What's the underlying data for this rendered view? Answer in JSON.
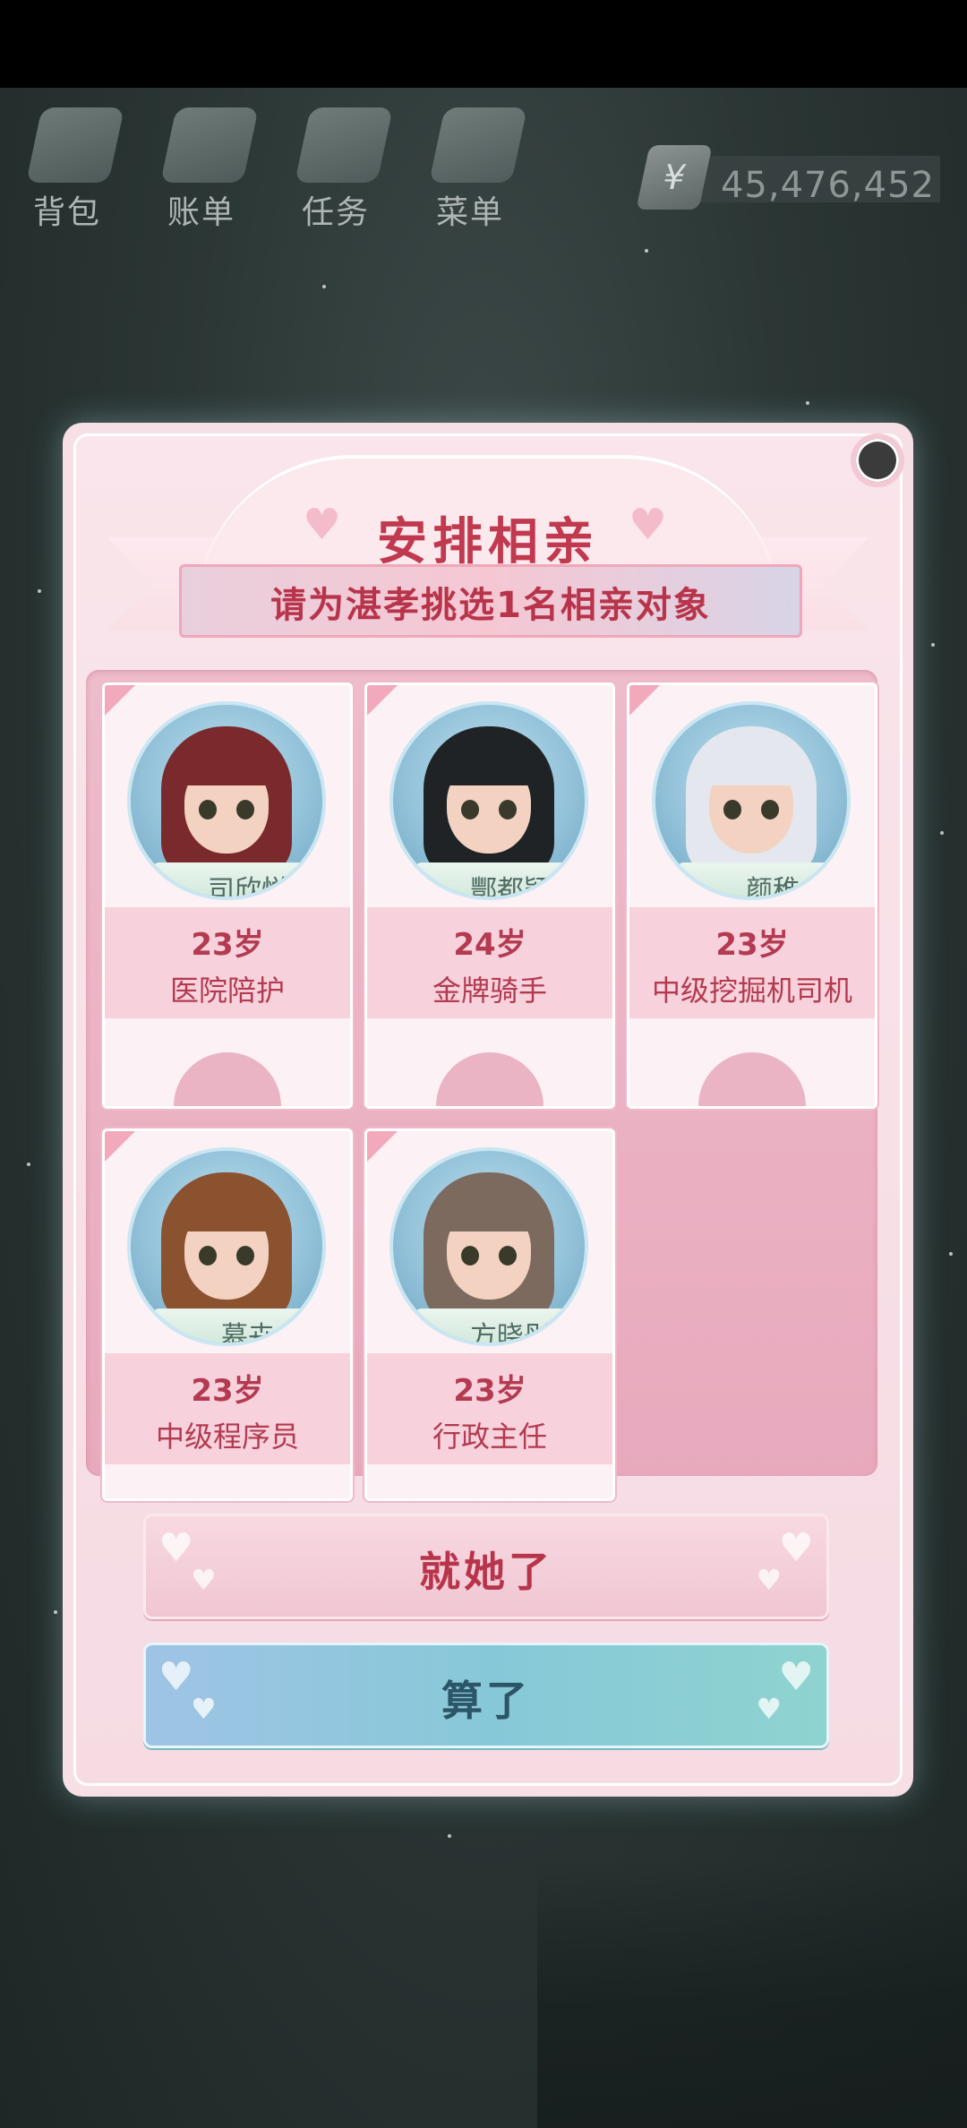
{
  "hud": {
    "items": [
      {
        "label": "背包",
        "icon": "bag-icon"
      },
      {
        "label": "账单",
        "icon": "bill-icon"
      },
      {
        "label": "任务",
        "icon": "task-icon"
      },
      {
        "label": "菜单",
        "icon": "menu-icon"
      }
    ],
    "money": {
      "symbol": "¥",
      "value": "45,476,452"
    }
  },
  "dialog": {
    "title": "安排相亲",
    "subtitle": "请为湛孝挑选1名相亲对象",
    "candidates": [
      {
        "name": "司欣悦",
        "age": "23岁",
        "job": "医院陪护",
        "hair": "#7a2a2c"
      },
      {
        "name": "酆都颖",
        "age": "24岁",
        "job": "金牌骑手",
        "hair": "#1f2326"
      },
      {
        "name": "颜稚",
        "age": "23岁",
        "job": "中级挖掘机司机",
        "hair": "#e4e8ee"
      },
      {
        "name": "慕卉",
        "age": "23岁",
        "job": "中级程序员",
        "hair": "#8b5230"
      },
      {
        "name": "方晓彤",
        "age": "23岁",
        "job": "行政主任",
        "hair": "#7d6a5e"
      }
    ],
    "confirm_label": "就她了",
    "cancel_label": "算了"
  },
  "colors": {
    "accent_text": "#b8344b",
    "dialog_bg": "#f7dfe6",
    "cancel_button": "#87c8d8"
  }
}
